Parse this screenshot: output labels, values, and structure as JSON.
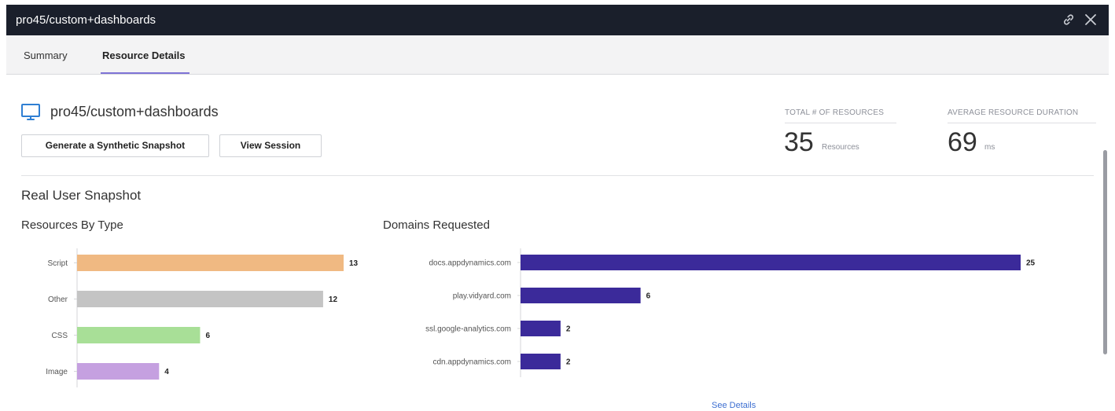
{
  "window": {
    "title": "pro45/custom+dashboards",
    "link_icon": "link-icon",
    "close_icon": "close-icon"
  },
  "tabs": [
    {
      "label": "Summary",
      "active": false
    },
    {
      "label": "Resource Details",
      "active": true
    }
  ],
  "header": {
    "page_icon": "monitor-icon",
    "page_name": "pro45/custom+dashboards",
    "buttons": {
      "synthetic": "Generate a Synthetic Snapshot",
      "session": "View Session"
    }
  },
  "stats": [
    {
      "label": "TOTAL # OF RESOURCES",
      "value": "35",
      "unit": "Resources"
    },
    {
      "label": "AVERAGE RESOURCE DURATION",
      "value": "69",
      "unit": "ms"
    }
  ],
  "section_title": "Real User Snapshot",
  "see_details": "See Details",
  "colors": {
    "titlebar": "#1a1f2b",
    "tab_accent": "#7e73d6",
    "domains_bar": "#3b2a9a",
    "link": "#3d6fd1"
  },
  "chart_data": [
    {
      "type": "bar",
      "orientation": "horizontal",
      "title": "Resources By Type",
      "categories": [
        "Script",
        "Other",
        "CSS",
        "Image"
      ],
      "values": [
        13,
        12,
        6,
        4
      ],
      "colors": [
        "#f0b982",
        "#c4c4c4",
        "#a8df97",
        "#c5a0e0"
      ],
      "xlim": [
        0,
        13
      ],
      "grid": false,
      "legend": "none"
    },
    {
      "type": "bar",
      "orientation": "horizontal",
      "title": "Domains Requested",
      "categories": [
        "docs.appdynamics.com",
        "play.vidyard.com",
        "ssl.google-analytics.com",
        "cdn.appdynamics.com"
      ],
      "values": [
        25,
        6,
        2,
        2
      ],
      "colors": [
        "#3b2a9a",
        "#3b2a9a",
        "#3b2a9a",
        "#3b2a9a"
      ],
      "xlim": [
        0,
        25
      ],
      "grid": false,
      "legend": "none"
    }
  ]
}
